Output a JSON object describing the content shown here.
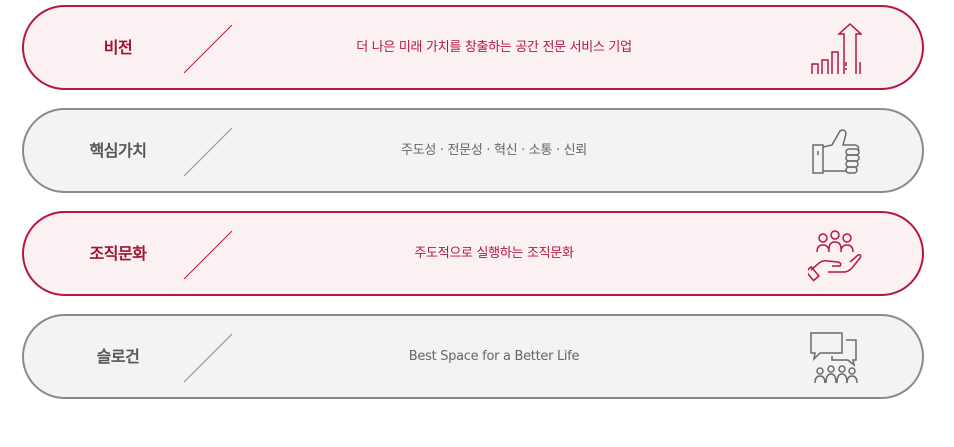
{
  "rows": [
    {
      "label": "비전",
      "description": "더 나은 미래 가치를 창출하는 공간 전문 서비스 기업",
      "icon": "growth-chart-icon",
      "style": "accent"
    },
    {
      "label": "핵심가치",
      "description": "주도성 · 전문성 · 혁신 · 소통 · 신뢰",
      "icon": "thumbs-up-icon",
      "style": "plain"
    },
    {
      "label": "조직문화",
      "description": "주도적으로 실행하는 조직문화",
      "icon": "hand-people-icon",
      "style": "accent"
    },
    {
      "label": "슬로건",
      "description": "Best Space for a Better Life",
      "icon": "chat-people-icon",
      "style": "plain"
    }
  ],
  "colors": {
    "accent": "#b5173f",
    "accent_bg": "#fbf0f2",
    "plain_border": "#8a8a8a",
    "plain_bg": "#f3f3f3"
  }
}
